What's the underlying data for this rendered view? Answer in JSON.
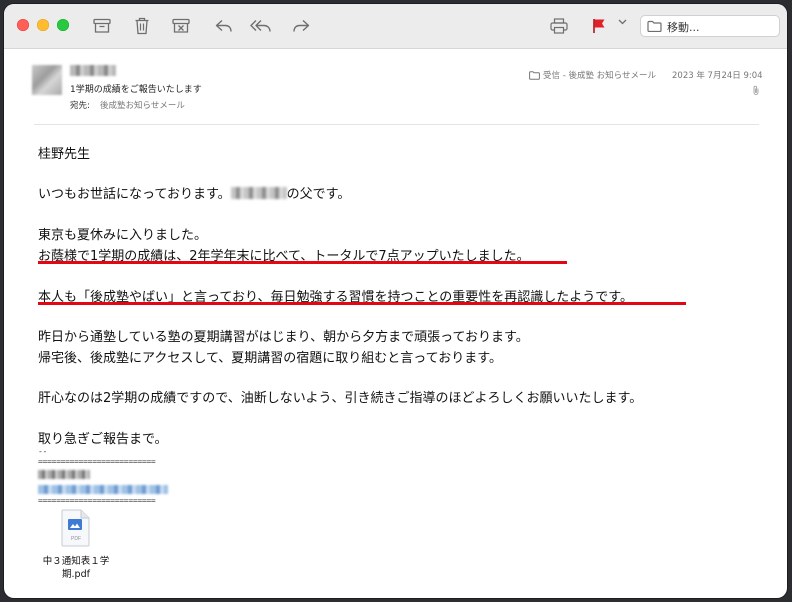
{
  "toolbar": {
    "move_label": "移動..."
  },
  "header": {
    "subject": "1学期の成績をご報告いたします",
    "to_label": "宛先:",
    "to_value": "後成塾お知らせメール",
    "mailbox": "受信 - 後成塾 お知らせメール",
    "date": "2023 年 7月24日 9:04"
  },
  "body": {
    "greeting": "桂野先生",
    "intro_prefix": "いつもお世話になっております。",
    "intro_suffix": "の父です。",
    "p1_l1": "東京も夏休みに入りました。",
    "p1_l2": "お蔭様で1学期の成績は、2年学年末に比べて、トータルで7点アップいたしました。",
    "p2": "本人も「後成塾やばい」と言っており、毎日勉強する習慣を持つことの重要性を再認識したようです。",
    "p3_l1": "昨日から通塾している塾の夏期講習がはじまり、朝から夕方まで頑張っております。",
    "p3_l2": "帰宅後、後成塾にアクセスして、夏期講習の宿題に取り組むと言っております。",
    "p4": "肝心なのは2学期の成績ですので、油断しないよう、引き続きご指導のほどよろしくお願いいたします。",
    "closing": "取り急ぎご報告まで。",
    "sig_dash": "--",
    "sig_rule": "=========================="
  },
  "attachment": {
    "name_l1": "中３通知表１学",
    "name_l2": "期.pdf",
    "badge": "PDF"
  },
  "colors": {
    "highlight": "#e30613",
    "flag": "#e0212a"
  }
}
